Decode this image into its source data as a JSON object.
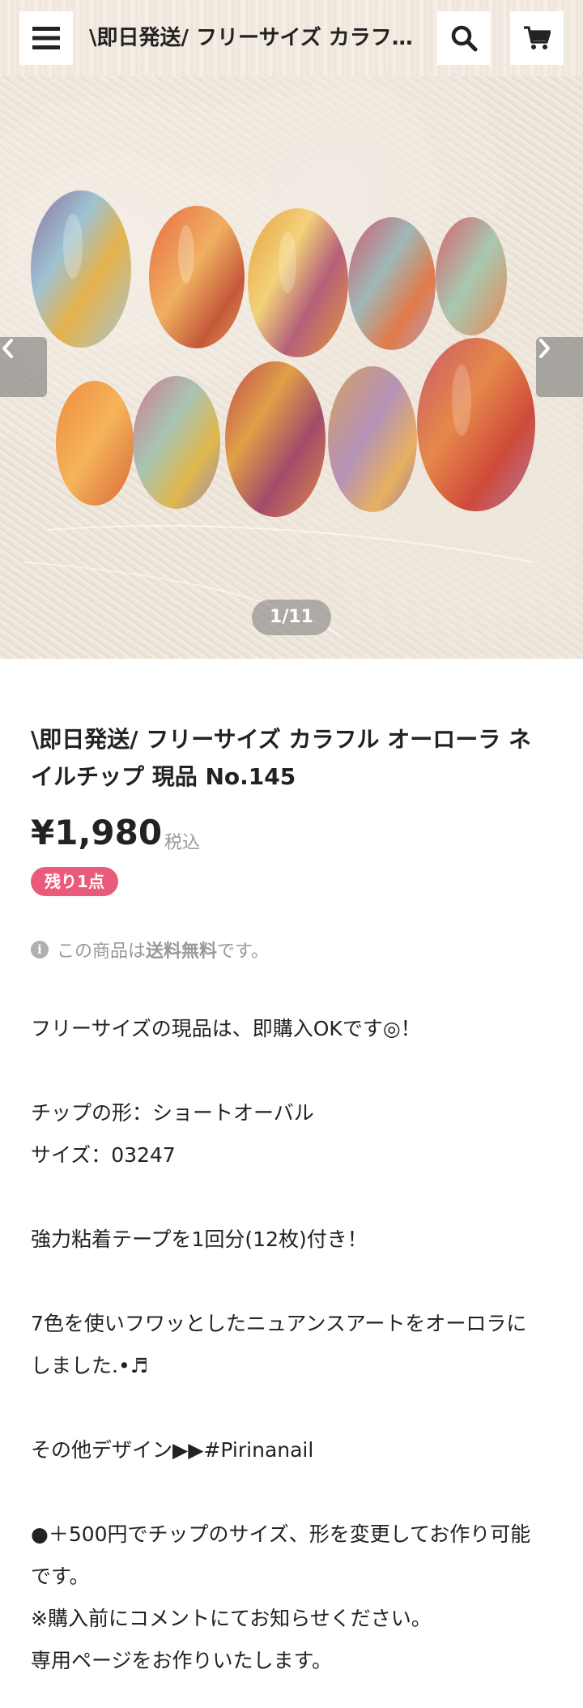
{
  "header": {
    "title": "\\即日発送/ フリーサイズ カラフル オーローラ ネイルチップ 現品 No.145",
    "menu_icon": "hamburger-icon",
    "search_icon": "search-icon",
    "cart_icon": "cart-icon"
  },
  "slider": {
    "counter": "1/11",
    "prev_icon": "chevron-left-icon",
    "next_icon": "chevron-right-icon"
  },
  "product": {
    "title": "\\即日発送/ フリーサイズ カラフル オーローラ ネイルチップ 現品 No.145",
    "price": "¥1,980",
    "tax_label": "税込",
    "stock_badge": "残り1点",
    "shipping_pre": "この商品は",
    "shipping_bold": "送料無料",
    "shipping_post": "です。"
  },
  "description": {
    "lines": [
      "フリーサイズの現品は、即購入OKです◎！",
      "",
      "チップの形：ショートオーバル",
      "サイズ：03247",
      "",
      "強力粘着テープを1回分(12枚)付き！",
      "",
      "7色を使いフワッとしたニュアンスアートをオーロラに",
      "しました.•♬",
      "",
      "その他デザイン▶▶#Pirinanail",
      "",
      "●＋500円でチップのサイズ、形を変更してお作り可能",
      "です。",
      "※購入前にコメントにてお知らせください。",
      "専用ページをお作りいたします。"
    ]
  },
  "colors": {
    "badge": "#ea5a7a",
    "muted": "#999999"
  }
}
